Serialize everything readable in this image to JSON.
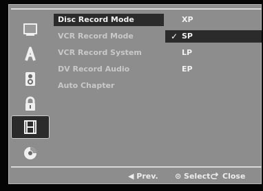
{
  "menu": {
    "items": [
      {
        "label": "Disc Record Mode"
      },
      {
        "label": "VCR Record Mode"
      },
      {
        "label": "VCR Record System"
      },
      {
        "label": "DV Record Audio"
      },
      {
        "label": "Auto Chapter"
      }
    ]
  },
  "options": {
    "items": [
      {
        "label": "XP"
      },
      {
        "label": "SP",
        "checked": true
      },
      {
        "label": "LP"
      },
      {
        "label": "EP"
      }
    ],
    "check_glyph": "✓"
  },
  "footer": {
    "prev": "◀ Prev.",
    "select": "⊙ Select",
    "close": "Close"
  },
  "sidebar": {
    "icons": [
      "monitor-icon",
      "language-icon",
      "speaker-icon",
      "lock-icon",
      "film-icon",
      "disc-icon"
    ]
  },
  "colors": {
    "selected_bg": "#2b2b2b",
    "frame_bg": "#8d8d8d",
    "text": "#f2f2f2"
  }
}
